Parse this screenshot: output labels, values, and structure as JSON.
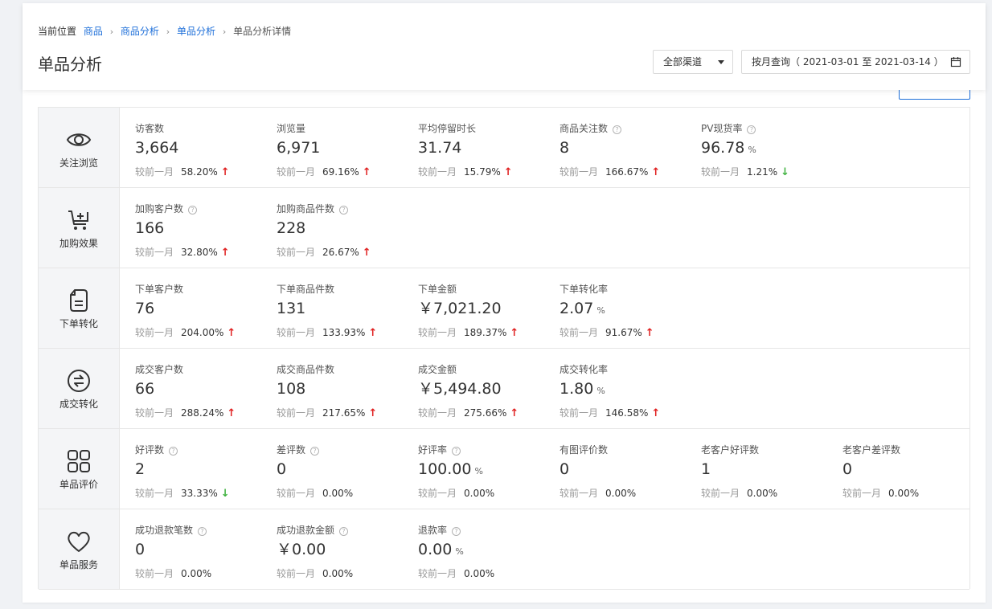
{
  "breadcrumb": {
    "prefix": "当前位置",
    "items": [
      "商品",
      "商品分析",
      "单品分析"
    ],
    "current": "单品分析详情"
  },
  "page_title": "单品分析",
  "filters": {
    "channel": "全部渠道",
    "date_range": "按月查询（ 2021-03-01 至 2021-03-14 ）"
  },
  "compare_label": "较前一月",
  "colors": {
    "link": "#1e6fd9",
    "up": "#e02020",
    "down": "#3fb23f"
  },
  "sections": [
    {
      "label": "关注浏览",
      "icon": "eye-icon",
      "metrics": [
        {
          "label": "访客数",
          "value": "3,664",
          "change": "58.20%",
          "trend": "up"
        },
        {
          "label": "浏览量",
          "value": "6,971",
          "change": "69.16%",
          "trend": "up"
        },
        {
          "label": "平均停留时长",
          "value": "31.74",
          "change": "15.79%",
          "trend": "up"
        },
        {
          "label": "商品关注数",
          "help": true,
          "value": "8",
          "change": "166.67%",
          "trend": "up"
        },
        {
          "label": "PV现货率",
          "help": true,
          "value": "96.78",
          "unit": "%",
          "change": "1.21%",
          "trend": "down"
        }
      ]
    },
    {
      "label": "加购效果",
      "icon": "cart-plus-icon",
      "metrics": [
        {
          "label": "加购客户数",
          "help": true,
          "value": "166",
          "change": "32.80%",
          "trend": "up"
        },
        {
          "label": "加购商品件数",
          "help": true,
          "value": "228",
          "change": "26.67%",
          "trend": "up"
        }
      ]
    },
    {
      "label": "下单转化",
      "icon": "order-icon",
      "metrics": [
        {
          "label": "下单客户数",
          "value": "76",
          "change": "204.00%",
          "trend": "up"
        },
        {
          "label": "下单商品件数",
          "value": "131",
          "change": "133.93%",
          "trend": "up"
        },
        {
          "label": "下单金额",
          "value": "￥7,021.20",
          "change": "189.37%",
          "trend": "up"
        },
        {
          "label": "下单转化率",
          "value": "2.07",
          "unit": "%",
          "change": "91.67%",
          "trend": "up"
        }
      ]
    },
    {
      "label": "成交转化",
      "icon": "exchange-icon",
      "metrics": [
        {
          "label": "成交客户数",
          "value": "66",
          "change": "288.24%",
          "trend": "up"
        },
        {
          "label": "成交商品件数",
          "value": "108",
          "change": "217.65%",
          "trend": "up"
        },
        {
          "label": "成交金额",
          "value": "￥5,494.80",
          "change": "275.66%",
          "trend": "up"
        },
        {
          "label": "成交转化率",
          "value": "1.80",
          "unit": "%",
          "change": "146.58%",
          "trend": "up"
        }
      ]
    },
    {
      "label": "单品评价",
      "icon": "grid-icon",
      "metrics": [
        {
          "label": "好评数",
          "help": true,
          "value": "2",
          "change": "33.33%",
          "trend": "down"
        },
        {
          "label": "差评数",
          "help": true,
          "value": "0",
          "change": "0.00%",
          "trend": "none"
        },
        {
          "label": "好评率",
          "help": true,
          "value": "100.00",
          "unit": "%",
          "change": "0.00%",
          "trend": "none"
        },
        {
          "label": "有图评价数",
          "value": "0",
          "change": "0.00%",
          "trend": "none"
        },
        {
          "label": "老客户好评数",
          "value": "1",
          "change": "0.00%",
          "trend": "none"
        },
        {
          "label": "老客户差评数",
          "value": "0",
          "change": "0.00%",
          "trend": "none"
        }
      ]
    },
    {
      "label": "单品服务",
      "icon": "heart-icon",
      "metrics": [
        {
          "label": "成功退款笔数",
          "help": true,
          "value": "0",
          "change": "0.00%",
          "trend": "none"
        },
        {
          "label": "成功退款金额",
          "help": true,
          "value": "￥0.00",
          "change": "0.00%",
          "trend": "none"
        },
        {
          "label": "退款率",
          "help": true,
          "value": "0.00",
          "unit": "%",
          "change": "0.00%",
          "trend": "none"
        }
      ]
    }
  ]
}
